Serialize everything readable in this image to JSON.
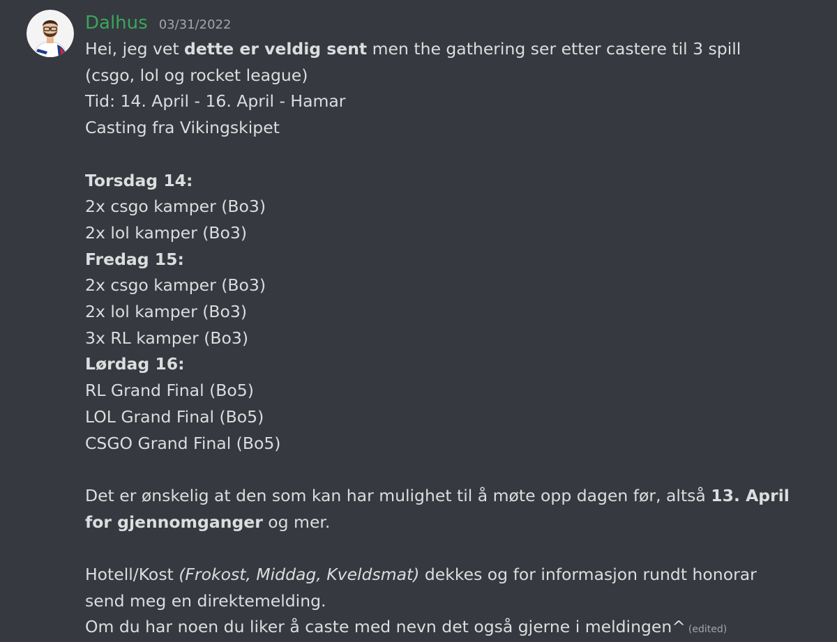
{
  "message": {
    "author": "Dalhus",
    "timestamp": "03/31/2022",
    "edited_label": "(edited)",
    "colors": {
      "background": "#36393f",
      "username": "#3ba55c",
      "text": "#dcddde",
      "muted": "#a3a6aa"
    },
    "avatar_icon": "user-avatar-icon",
    "intro": {
      "part1": "Hei, jeg vet ",
      "bold": "dette er veldig sent",
      "part2": " men the gathering ser etter castere til 3 spill (csgo, lol og rocket league)"
    },
    "time_line": "Tid: 14. April - 16. April - Hamar",
    "location_line": "Casting fra Vikingskipet",
    "schedule": {
      "thursday": {
        "heading": "Torsdag 14:",
        "items": [
          "2x csgo kamper (Bo3)",
          "2x lol kamper (Bo3)"
        ]
      },
      "friday": {
        "heading": "Fredag 15:",
        "items": [
          "2x csgo kamper (Bo3)",
          "2x lol kamper (Bo3)",
          "3x RL kamper (Bo3)"
        ]
      },
      "saturday": {
        "heading": "Lørdag 16:",
        "items": [
          "RL Grand Final (Bo5)",
          "LOL Grand Final (Bo5)",
          "CSGO Grand Final (Bo5)"
        ]
      }
    },
    "prep": {
      "part1": "Det er ønskelig at den som kan har mulighet til å møte opp dagen før, altså ",
      "bold": "13. April for gjennomganger",
      "part2": " og mer."
    },
    "hotel": {
      "part1": "Hotell/Kost ",
      "italic": "(Frokost, Middag, Kveldsmat)",
      "part2": " dekkes og for informasjon rundt honorar send meg en direktemelding."
    },
    "closing": "Om du har noen du liker å caste med nevn det også gjerne i meldingen^"
  }
}
